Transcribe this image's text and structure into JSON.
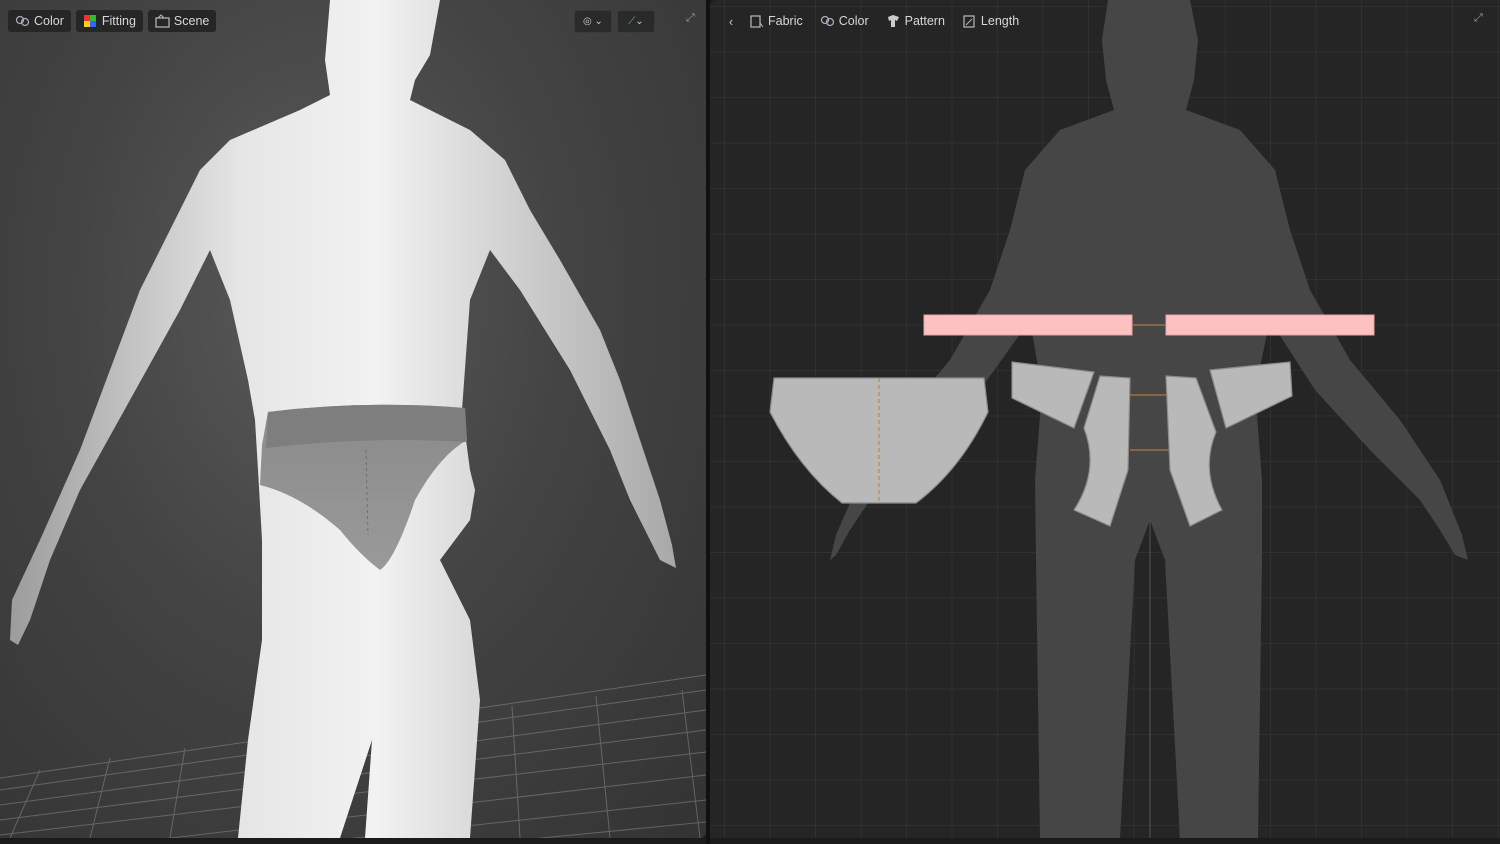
{
  "left_toolbar": {
    "items": [
      {
        "label": "Color",
        "icon": "fabric-color-icon"
      },
      {
        "label": "Fitting",
        "icon": "fitting-palette-icon"
      },
      {
        "label": "Scene",
        "icon": "scene-icon"
      }
    ]
  },
  "right_toolbar": {
    "items": [
      {
        "label": "Fabric",
        "icon": "fabric-icon"
      },
      {
        "label": "Color",
        "icon": "color-icon"
      },
      {
        "label": "Pattern",
        "icon": "pattern-icon"
      },
      {
        "label": "Length",
        "icon": "length-icon"
      }
    ]
  },
  "colors": {
    "waistband_pieces": "#ffc0c0",
    "pattern_pieces": "#b9b9b9",
    "seam_line": "#c8873a",
    "avatar_silhouette": "#454545",
    "garment_3d": "#8d8d8d"
  }
}
